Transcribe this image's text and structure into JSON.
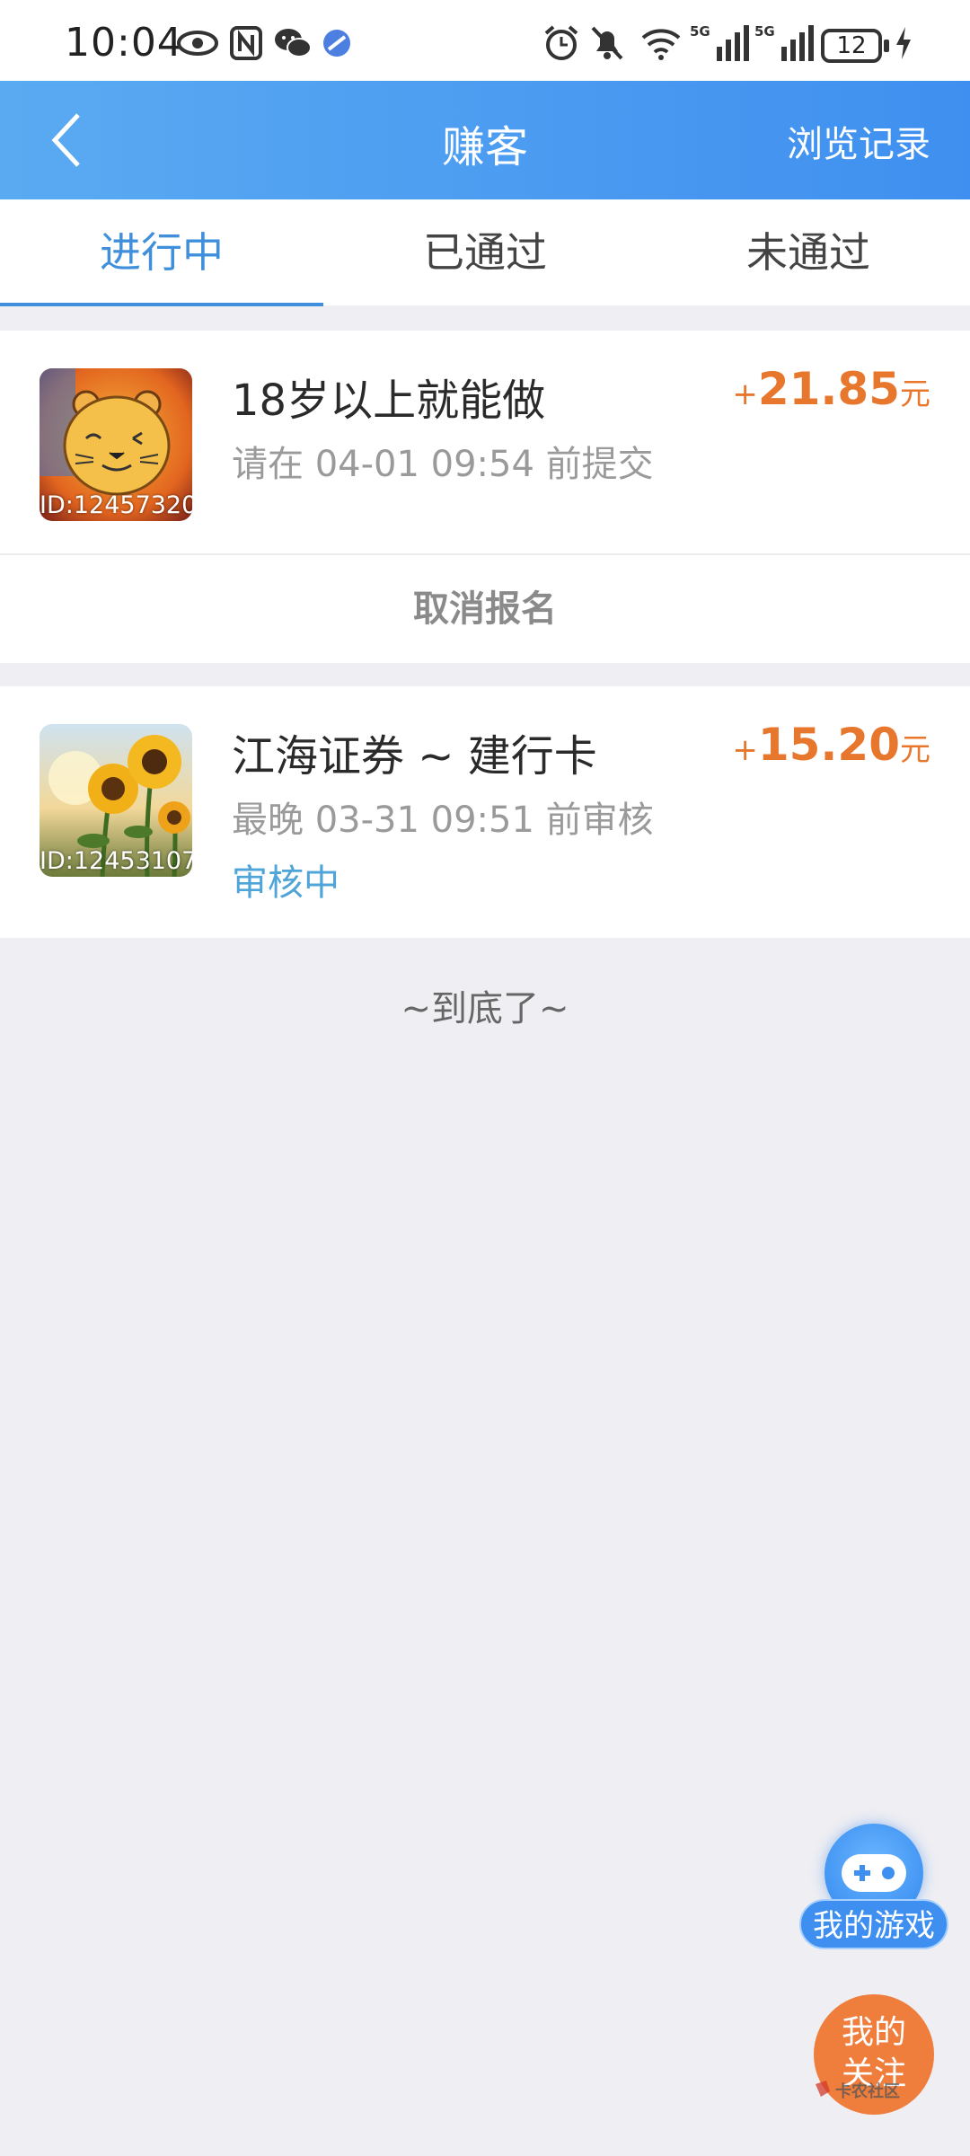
{
  "status_bar": {
    "time": "10:04",
    "battery": "12",
    "network_1": "5G",
    "network_2": "5G"
  },
  "header": {
    "title": "赚客",
    "history_label": "浏览记录"
  },
  "tabs": [
    {
      "label": "进行中",
      "active": true
    },
    {
      "label": "已通过",
      "active": false
    },
    {
      "label": "未通过",
      "active": false
    }
  ],
  "tasks": [
    {
      "title": "18岁以上就能做",
      "subtitle": "请在 04-01 09:54 前提交",
      "reward_plus": "+",
      "reward_amount": "21.85",
      "reward_unit": "元",
      "thumb_id": "ID:12457320",
      "action_label": "取消报名"
    },
    {
      "title": "江海证券 ~ 建行卡",
      "subtitle": "最晚 03-31 09:51 前审核",
      "reward_plus": "+",
      "reward_amount": "15.20",
      "reward_unit": "元",
      "thumb_id": "ID:12453107",
      "status": "审核中"
    }
  ],
  "list_end": "~到底了~",
  "fab": {
    "game_label": "我的游戏",
    "follow_line1": "我的",
    "follow_line2": "关注"
  },
  "watermark": "卡农社区",
  "colors": {
    "header": "#3f8ff0",
    "accent": "#3f8fdc",
    "reward": "#e8772e",
    "status": "#4fa4d8",
    "background": "#eeeef3"
  }
}
